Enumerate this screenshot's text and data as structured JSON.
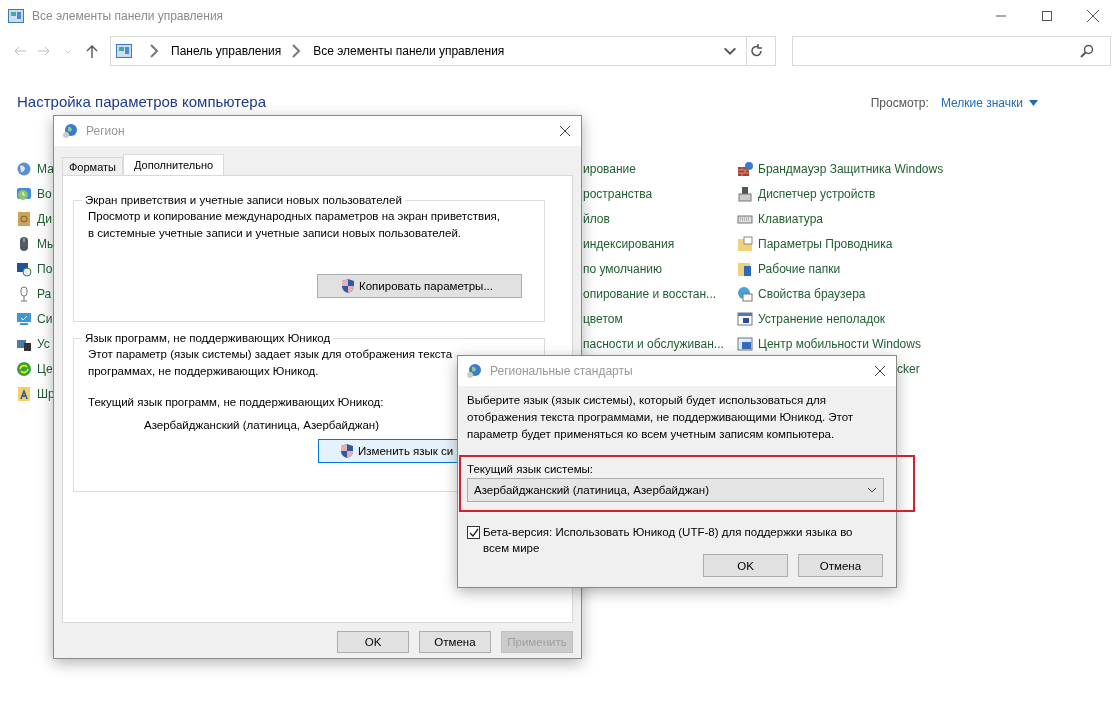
{
  "window": {
    "title": "Все элементы панели управления"
  },
  "address_bar": {
    "path": [
      "Панель управления",
      "Все элементы панели управления"
    ]
  },
  "heading": "Настройка параметров компьютера",
  "view": {
    "label": "Просмотр:",
    "value": "Мелкие значки"
  },
  "columns": [
    [
      {
        "kind": "icon",
        "label": "Ма"
      },
      {
        "kind": "icon",
        "label": "Во"
      },
      {
        "kind": "icon",
        "label": "Ди"
      },
      {
        "kind": "icon",
        "label": "Мы"
      },
      {
        "kind": "icon",
        "label": "По"
      },
      {
        "kind": "icon",
        "label": "Ра"
      },
      {
        "kind": "icon",
        "label": "Си"
      },
      {
        "kind": "icon",
        "label": "Ус"
      },
      {
        "kind": "icon",
        "label": "Це"
      },
      {
        "kind": "icon",
        "label": "Шр"
      }
    ],
    [
      {
        "kind": "text",
        "label": "ирование"
      },
      {
        "kind": "text",
        "label": "ространства"
      },
      {
        "kind": "text",
        "label": "йлов"
      },
      {
        "kind": "text",
        "label": "индексирования"
      },
      {
        "kind": "text",
        "label": "по умолчанию"
      },
      {
        "kind": "text",
        "label": "опирование и восстан..."
      },
      {
        "kind": "text",
        "label": "цветом"
      },
      {
        "kind": "text",
        "label": "пасности и обслуживан..."
      }
    ],
    [
      {
        "kind": "icon",
        "label": "Брандмауэр Защитника Windows"
      },
      {
        "kind": "icon",
        "label": "Диспетчер устройств"
      },
      {
        "kind": "icon",
        "label": "Клавиатура"
      },
      {
        "kind": "icon",
        "label": "Параметры Проводника"
      },
      {
        "kind": "icon",
        "label": "Рабочие папки"
      },
      {
        "kind": "icon",
        "label": "Свойства браузера"
      },
      {
        "kind": "icon",
        "label": "Устранение неполадок"
      },
      {
        "kind": "icon",
        "label": "Центр мобильности Windows"
      },
      {
        "kind": "text",
        "label": "cker"
      }
    ]
  ],
  "region_dialog": {
    "title": "Регион",
    "tabs": [
      {
        "label": "Форматы",
        "selected": false
      },
      {
        "label": "Дополнительно",
        "selected": true
      }
    ],
    "groups": [
      {
        "legend": "Экран приветствия и учетные записи новых пользователей",
        "text": "Просмотр и копирование международных параметров на экран приветствия,\nв системные учетные записи и учетные записи новых пользователей.",
        "button": {
          "label": "Копировать параметры...",
          "hovered": false
        }
      },
      {
        "legend": "Язык программ, не поддерживающих Юникод",
        "text": "Этот параметр (язык системы) задает язык для отображения текста\nпрограммах, не поддерживающих Юникод.",
        "current_label": "Текущий язык программ, не поддерживающих Юникод:",
        "current_value": "Азербайджанский (латиница, Азербайджан)",
        "button": {
          "label": "Изменить язык си",
          "hovered": true
        }
      }
    ],
    "buttons": [
      {
        "label": "OK",
        "disabled": false
      },
      {
        "label": "Отмена",
        "disabled": false
      },
      {
        "label": "Применить",
        "disabled": true
      }
    ]
  },
  "locale_dialog": {
    "title": "Региональные стандарты",
    "text": "Выберите язык (язык системы), который будет использоваться для\nотображения текста программами, не поддерживающими Юникод. Этот\nпараметр будет применяться ко всем учетным записям компьютера.",
    "select_label": "Текущий язык системы:",
    "select_value": "Азербайджанский (латиница, Азербайджан)",
    "checkbox": {
      "label": "Бета-версия: Использовать Юникод (UTF-8) для поддержки языка во всем мире",
      "checked": true
    },
    "buttons": [
      {
        "label": "OK",
        "disabled": false
      },
      {
        "label": "Отмена",
        "disabled": false
      }
    ]
  }
}
